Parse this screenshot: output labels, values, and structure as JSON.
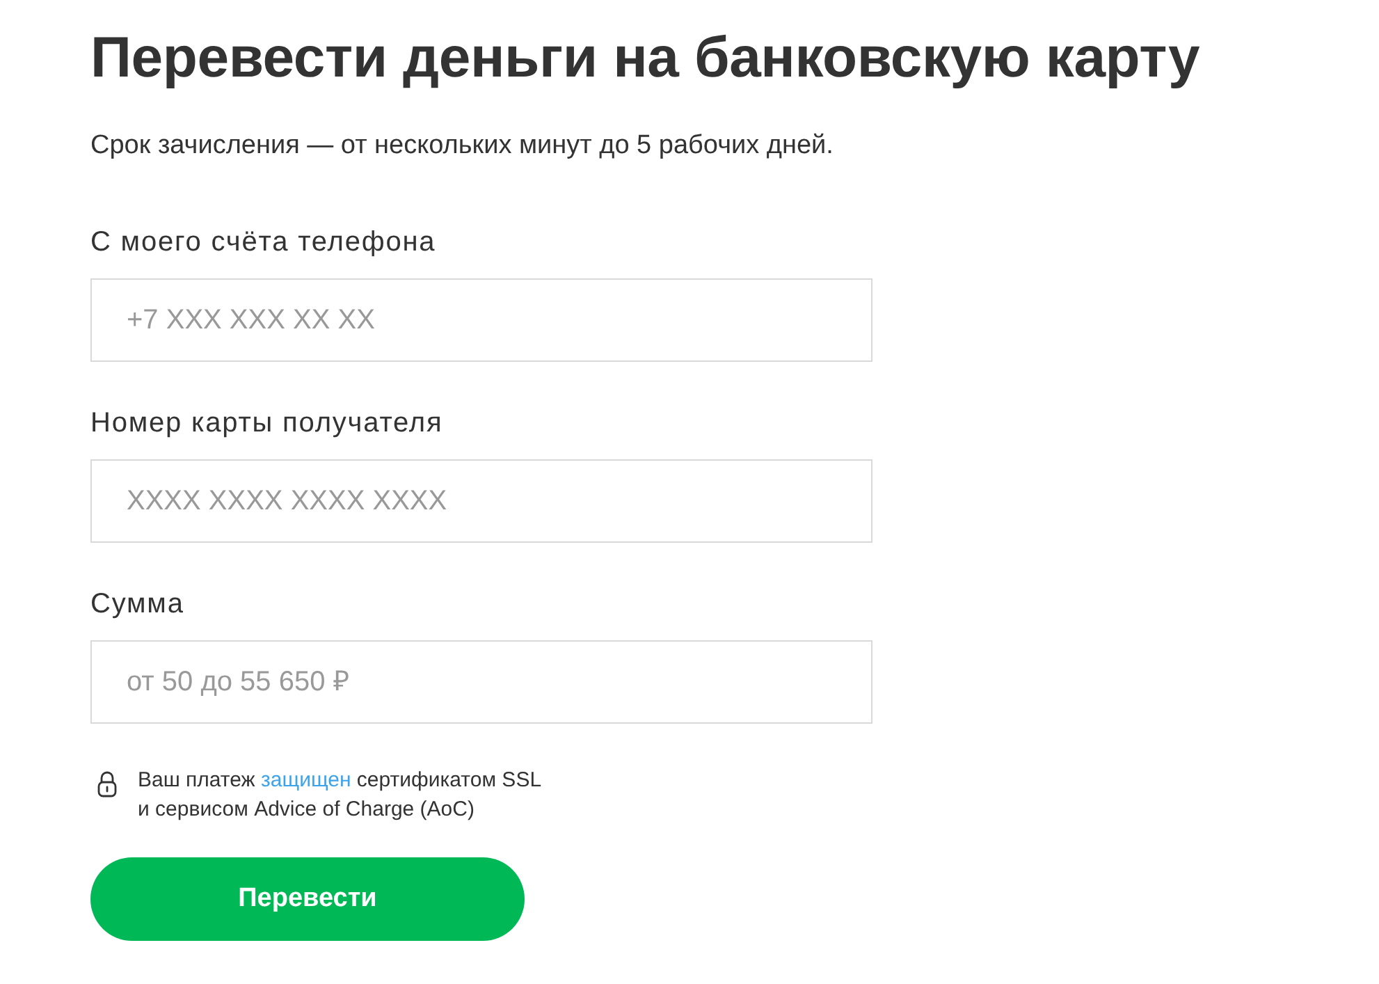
{
  "title": "Перевести деньги на банковскую карту",
  "subtitle": "Срок зачисления — от нескольких минут до 5 рабочих дней.",
  "fields": [
    {
      "label": "С моего счёта телефона",
      "placeholder": "+7 XXX XXX XX XX"
    },
    {
      "label": "Номер карты получателя",
      "placeholder": "XXXX XXXX XXXX XXXX"
    },
    {
      "label": "Сумма",
      "placeholder": "от 50 до 55 650 ₽"
    }
  ],
  "security_note": {
    "text_before": "Ваш платеж",
    "link": "защищен",
    "text_after": "сертификатом SSL",
    "text_line_2": "и сервисом Advice of Charge (AoC)"
  },
  "submit_button": "Перевести"
}
